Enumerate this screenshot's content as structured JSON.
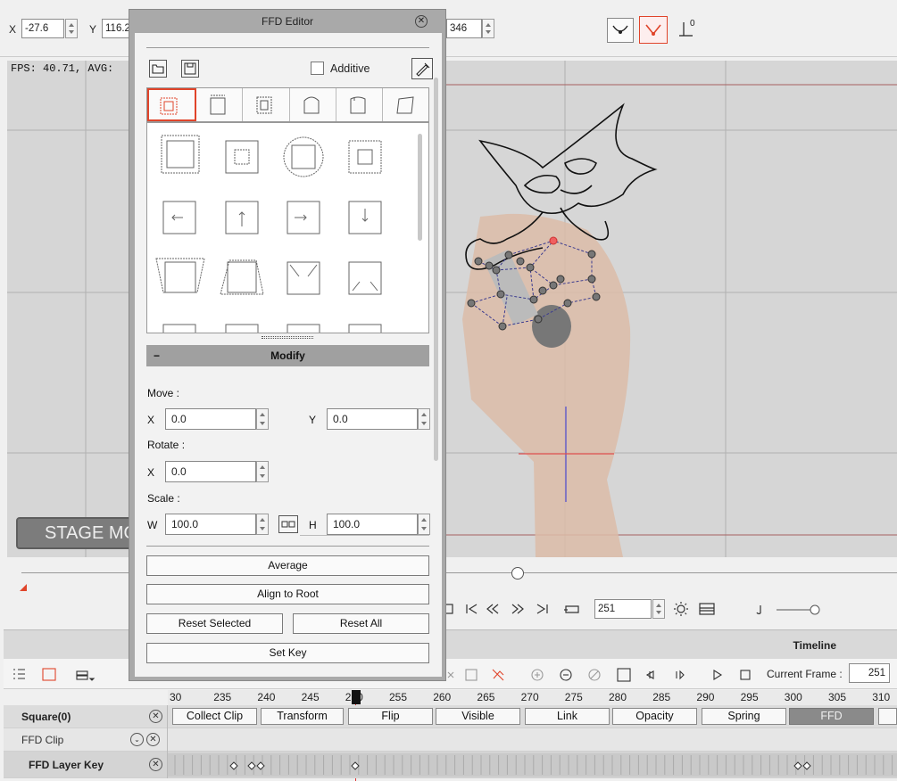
{
  "toolbar": {
    "x_label": "X",
    "x_value": "-27.6",
    "y_label": "Y",
    "y_value": "116.2",
    "z_value": "346",
    "snap_value_label": "0"
  },
  "viewport": {
    "fps_text": "FPS: 40.71, AVG:",
    "stage_mode_label": "STAGE MO"
  },
  "playback": {
    "frame_value": "251"
  },
  "ffd_editor": {
    "title": "FFD Editor",
    "additive_label": "Additive",
    "additive_checked": false,
    "modify_label": "Modify",
    "move_label": "Move :",
    "move_x_label": "X",
    "move_x": "0.0",
    "move_y_label": "Y",
    "move_y": "0.0",
    "rotate_label": "Rotate :",
    "rotate_x_label": "X",
    "rotate_x": "0.0",
    "scale_label": "Scale :",
    "scale_w_label": "W",
    "scale_w": "100.0",
    "scale_h_label": "H",
    "scale_h": "100.0",
    "average_label": "Average",
    "align_root_label": "Align to Root",
    "reset_selected_label": "Reset Selected",
    "reset_all_label": "Reset All",
    "set_key_label": "Set Key"
  },
  "timeline": {
    "title": "Timeline",
    "current_frame_label": "Current Frame :",
    "current_frame": "251",
    "ruler_ticks": [
      "30",
      "235",
      "240",
      "245",
      "250",
      "255",
      "260",
      "265",
      "270",
      "275",
      "280",
      "285",
      "290",
      "295",
      "300",
      "305",
      "310"
    ],
    "tracks": [
      {
        "name": "Square(0)"
      },
      {
        "name": "FFD Clip"
      },
      {
        "name": "FFD Layer Key"
      }
    ],
    "chips": [
      "Collect Clip",
      "Transform",
      "Flip",
      "Visible",
      "Link",
      "Opacity",
      "Spring",
      "FFD"
    ],
    "active_chip": "FFD"
  },
  "colors": {
    "accent": "#e0442a",
    "panel_header": "#a9a9a9",
    "viewport_bg": "#d6d6d6"
  }
}
